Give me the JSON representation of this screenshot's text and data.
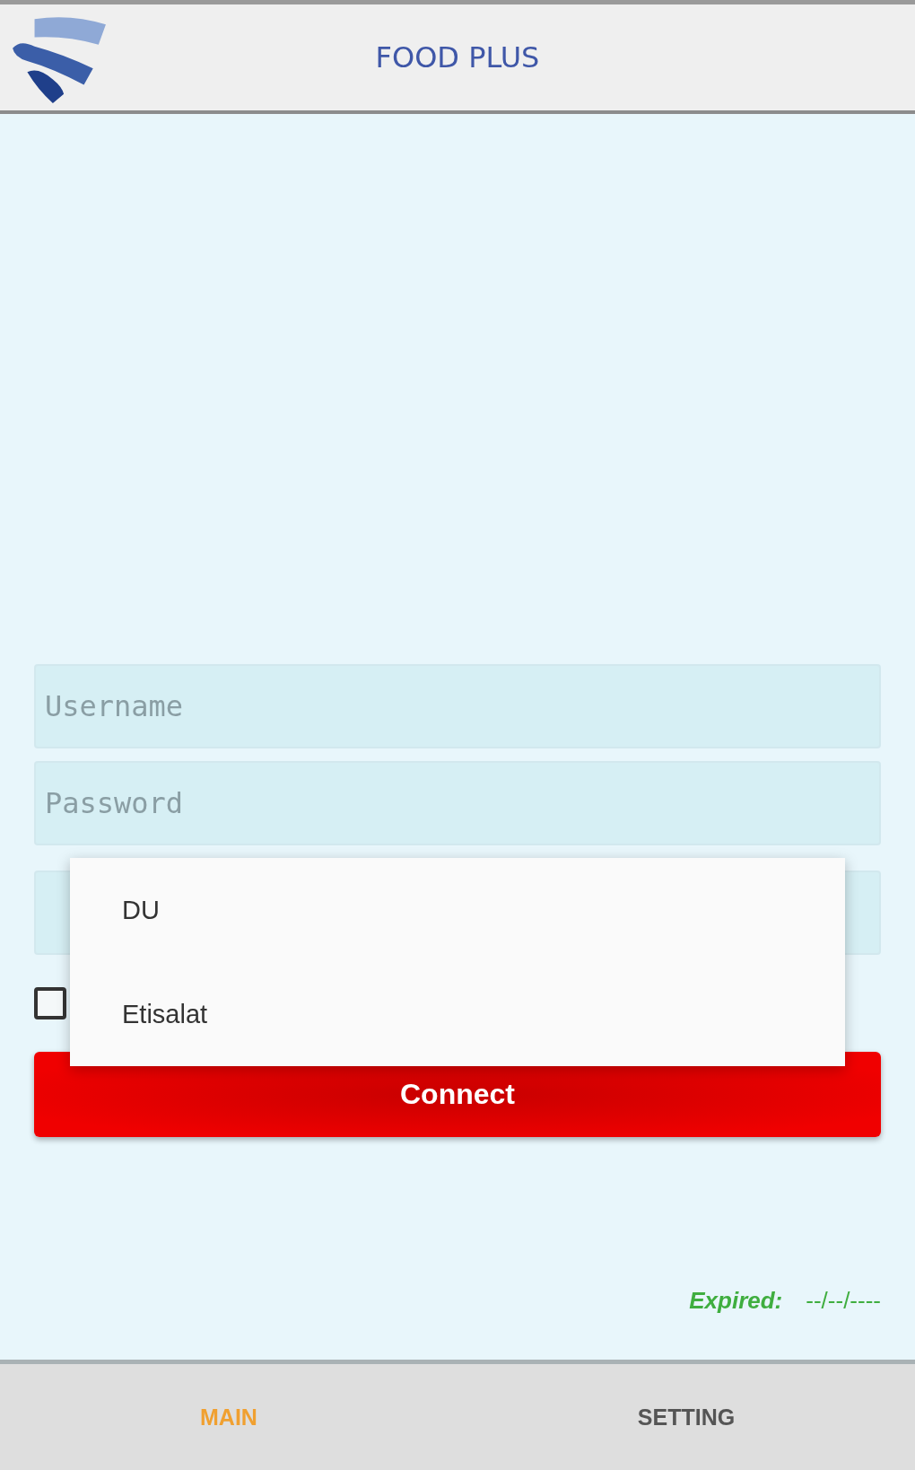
{
  "header": {
    "title": "FOOD PLUS"
  },
  "form": {
    "username": {
      "placeholder": "Username"
    },
    "password": {
      "placeholder": "Password"
    },
    "remember": {
      "checked": false
    }
  },
  "dropdown": {
    "options": [
      {
        "label": "DU"
      },
      {
        "label": "Etisalat"
      }
    ]
  },
  "connect_button": "Connect",
  "expiry": {
    "label": "Expired:",
    "value": "--/--/----"
  },
  "tabs": [
    {
      "label": "MAIN",
      "selected": true
    },
    {
      "label": "SETTING",
      "selected": false
    }
  ]
}
